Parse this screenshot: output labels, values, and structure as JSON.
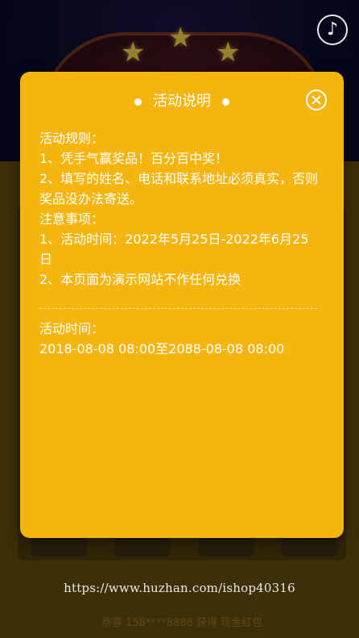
{
  "music_button": {
    "icon": "music-note-icon",
    "glyph": "♪"
  },
  "background": {
    "footer_url": "https://www.huzhan.com/ishop40316",
    "ticker_text": "恭喜 158****8888 获得 现金红包"
  },
  "modal": {
    "title": "活动说明",
    "rules_heading": "活动规则：",
    "rules": [
      "1、凭手气赢奖品！百分百中奖！",
      "2、填写的姓名、电话和联系地址必须真实，否则奖品没办法寄送。"
    ],
    "notes_heading": "注意事项：",
    "notes": [
      "1、活动时间：2022年5月25日-2022年6月25日",
      "2、本页面为演示网站不作任何兑换"
    ],
    "time_heading": "活动时间：",
    "time_value": "2018-08-08 08:00至2088-08-08 08:00"
  },
  "colors": {
    "modal_bg": "#f6b50e",
    "text": "#ffffff",
    "page_bg": "#0b0b2a"
  }
}
